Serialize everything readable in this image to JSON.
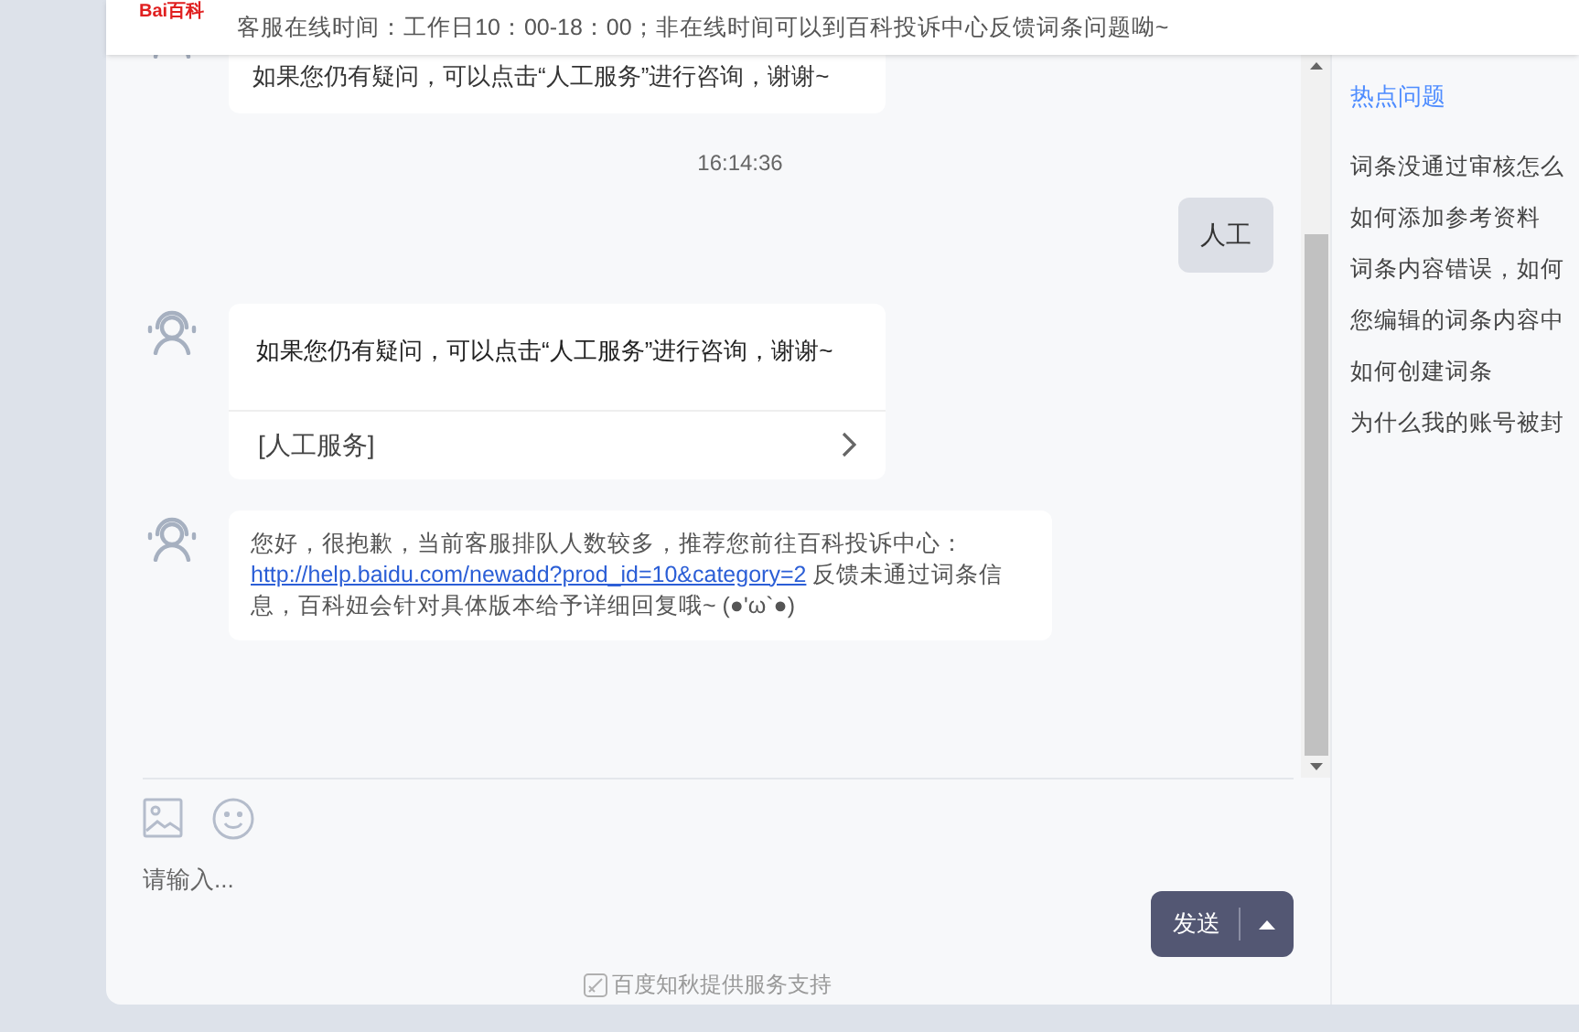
{
  "header": {
    "logo_text": "Bai百科",
    "notice": "客服在线时间：工作日10：00-18：00；非在线时间可以到百科投诉中心反馈词条问题呦~"
  },
  "messages": [
    {
      "kind": "bot_text",
      "text": "如果您仍有疑问，可以点击“人工服务”进行咨询，谢谢~"
    },
    {
      "kind": "timestamp",
      "text": "16:14:36"
    },
    {
      "kind": "user_text",
      "text": "人工"
    },
    {
      "kind": "bot_card",
      "text": "如果您仍有疑问，可以点击“人工服务”进行咨询，谢谢~",
      "action": "[人工服务]"
    },
    {
      "kind": "bot_link",
      "text_before": "您好，很抱歉，当前客服排队人数较多，推荐您前往百科投诉中心：",
      "link": "http://help.baidu.com/newadd?prod_id=10&category=2",
      "text_after": " 反馈未通过词条信息，百科妞会针对具体版本给予详细回复哦~ (●'ω`●)"
    }
  ],
  "composer": {
    "placeholder": "请输入...",
    "send": "发送"
  },
  "footer": "百度知秋提供服务支持",
  "sidebar": {
    "title": "热点问题",
    "items": [
      "词条没通过审核怎么",
      "如何添加参考资料",
      "词条内容错误，如何",
      "您编辑的词条内容中",
      "如何创建词条",
      "为什么我的账号被封"
    ]
  }
}
